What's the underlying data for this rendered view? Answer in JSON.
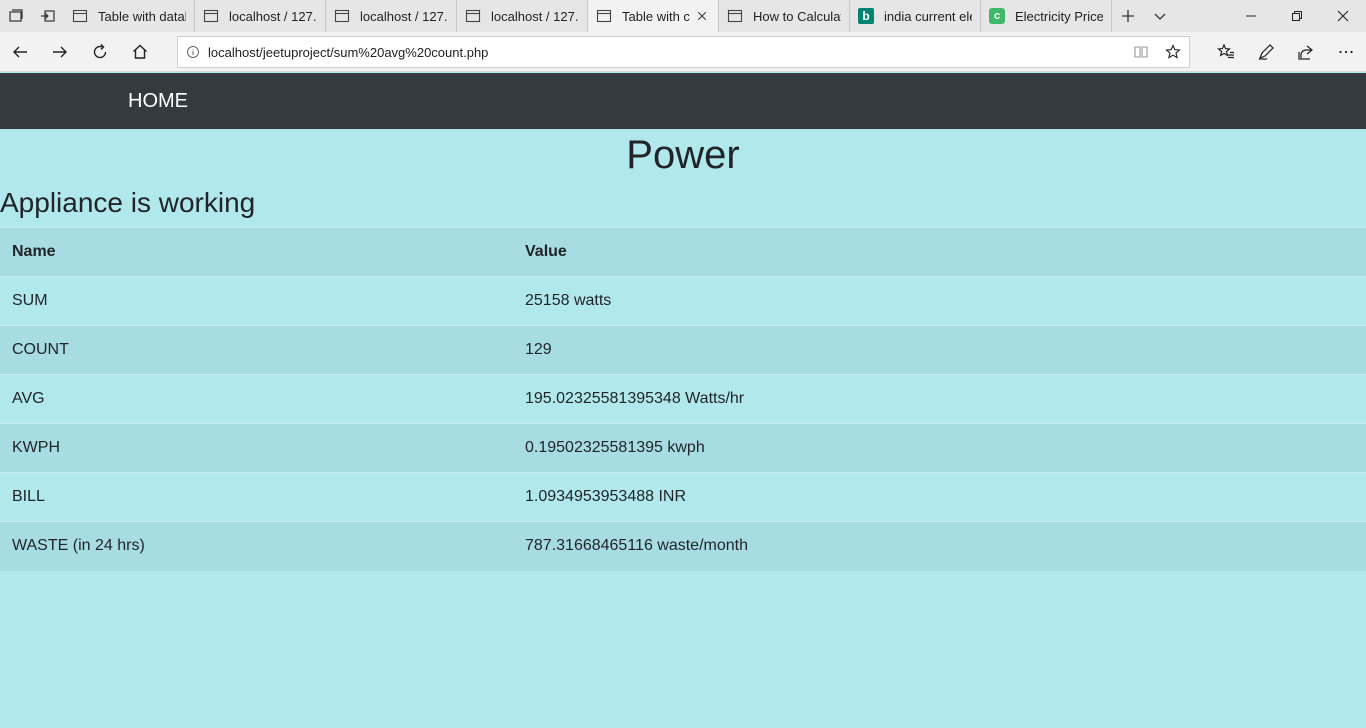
{
  "browser": {
    "tabs": [
      {
        "title": "Table with datal",
        "icon": "page-icon",
        "active": false
      },
      {
        "title": "localhost / 127.",
        "icon": "page-icon",
        "active": false
      },
      {
        "title": "localhost / 127.",
        "icon": "page-icon",
        "active": false
      },
      {
        "title": "localhost / 127.",
        "icon": "page-icon",
        "active": false
      },
      {
        "title": "Table with c",
        "icon": "page-icon",
        "active": true
      },
      {
        "title": "How to Calculat",
        "icon": "page-icon",
        "active": false
      },
      {
        "title": "india current ele",
        "icon": "bing-icon",
        "active": false
      },
      {
        "title": "Electricity Price",
        "icon": "c-site-icon",
        "active": false
      }
    ],
    "url": "localhost/jeetuproject/sum%20avg%20count.php",
    "bing_glyph": "b",
    "c_glyph": "c"
  },
  "page": {
    "nav": {
      "home_label": "HOME"
    },
    "title": "Power",
    "status": "Appliance is working",
    "table": {
      "headers": [
        "Name",
        "Value"
      ],
      "rows": [
        [
          "SUM",
          "25158 watts"
        ],
        [
          "COUNT",
          "129"
        ],
        [
          "AVG",
          "195.02325581395348 Watts/hr"
        ],
        [
          "KWPH",
          "0.19502325581395 kwph"
        ],
        [
          "BILL",
          "1.0934953953488 INR"
        ],
        [
          "WASTE (in 24 hrs)",
          "787.31668465116 waste/month"
        ]
      ]
    }
  },
  "colors": {
    "page_background": "#b0e8ec",
    "stripe": "#a7dde2",
    "navbar": "#343a40"
  }
}
